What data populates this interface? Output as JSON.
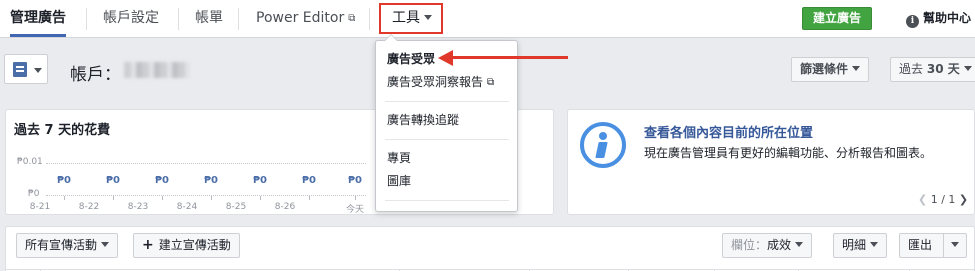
{
  "topnav": {
    "tabs": [
      {
        "label": "管理廣告"
      },
      {
        "label": "帳戶設定"
      },
      {
        "label": "帳單"
      },
      {
        "label": "Power Editor"
      }
    ],
    "tools_label": "工具",
    "create_ad_label": "建立廣告",
    "help_label": "幫助中心"
  },
  "account": {
    "label": "帳戶："
  },
  "filters": {
    "filter_label": "篩選條件",
    "date_prefix": "過去",
    "date_value": "30 天"
  },
  "spend_card": {
    "title_prefix": "過去",
    "title_days": "7",
    "title_suffix": "天的花費",
    "y_top": "₱0.01",
    "y_bottom": "₱0",
    "values": [
      "₱0",
      "₱0",
      "₱0",
      "₱0",
      "₱0",
      "₱0",
      "₱0"
    ],
    "dates": [
      "8-21",
      "8-22",
      "8-23",
      "8-24",
      "8-25",
      "8-26",
      "今天"
    ]
  },
  "news_card": {
    "title": "查看各個內容目前的所在位置",
    "body": "現在廣告管理員有更好的編輯功能、分析報告和圖表。",
    "pager": "1 / 1"
  },
  "tools_menu": {
    "items": [
      {
        "label": "廣告受眾"
      },
      {
        "label": "廣告受眾洞察報告"
      },
      {
        "label": "廣告轉換追蹤"
      },
      {
        "label": "專頁"
      },
      {
        "label": "圖庫"
      }
    ]
  },
  "toolbar": {
    "all_campaigns": "所有宣傳活動",
    "create_campaign": "建立宣傳活動",
    "columns_prefix": "欄位：",
    "columns_value": "成效",
    "breakdown": "明細",
    "export": "匯出"
  },
  "colors": {
    "accent": "#4267b2",
    "highlight": "#e0392c",
    "create_button": "#42a341",
    "link": "#365899"
  }
}
